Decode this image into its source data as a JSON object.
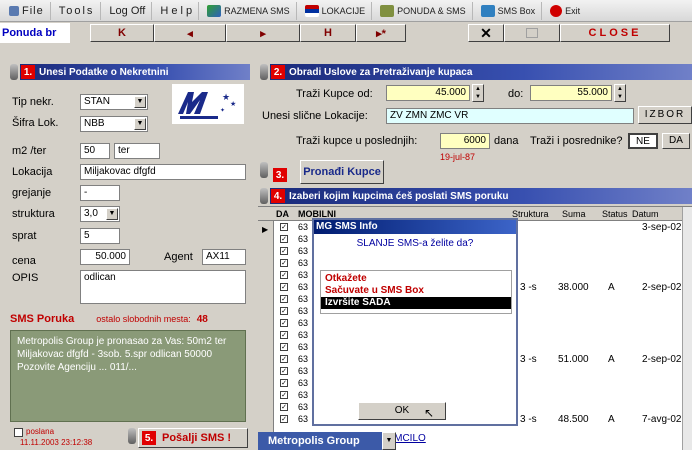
{
  "menu": {
    "file": "File",
    "tools": "Tools",
    "logoff": "Log Off",
    "help": "H e l p",
    "razmena": "RAZMENA SMS",
    "lokacije": "LOKACIJE",
    "ponuda_sms": "PONUDA & SMS",
    "sms_box": "SMS Box",
    "exit": "Exit"
  },
  "nav": {
    "ponuda_label": "Ponuda br",
    "btn_first": "K",
    "btn_prev": "◂",
    "btn_next": "▸",
    "btn_last": "H",
    "btn_new": "▸*",
    "btn_delete": "✕",
    "close": "CLOSE"
  },
  "section1": {
    "num": "1.",
    "title": "Unesi Podatke o Nekretnini",
    "tip_label": "Tip nekr.",
    "tip_value": "STAN",
    "sifra_label": "Šifra Lok.",
    "sifra_value": "NBB",
    "m2_label": "m2  /ter",
    "m2_value": "50",
    "ter_value": "ter",
    "lokacija_label": "Lokacija",
    "lokacija_value": "Miljakovac dfgfd",
    "grejanje_label": "grejanje",
    "grejanje_value": "-",
    "struktura_label": "struktura",
    "struktura_value": "3,0",
    "sprat_label": "sprat",
    "sprat_value": "5",
    "cena_label": "cena",
    "cena_value": "50.000",
    "agent_label": "Agent",
    "agent_value": "AX11",
    "opis_label": "OPIS",
    "opis_value": "odlican"
  },
  "sms": {
    "title": "SMS Poruka",
    "remaining_label": "ostalo slobodnih mesta:",
    "remaining_value": "48",
    "text": "Metropolis Group je pronasao za Vas: 50m2 ter Miljakovac dfgfd - 3sob. 5.spr odlican 50000 Pozovite Agenciju ... 011/...",
    "poslana_label": "poslana",
    "timestamp": "11.11.2003 23:12:38",
    "send_num": "5.",
    "send_label": "Pošalji SMS !"
  },
  "section2": {
    "num": "2.",
    "title": "Obradi Uslove za Pretraživanje kupaca",
    "trazi_od_label": "Traži Kupce od:",
    "trazi_od_value": "45.000",
    "do_label": "do:",
    "do_value": "55.000",
    "slicne_label": "Unesi slične Lokacije:",
    "slicne_value": "ZV ZMN ZMC VR",
    "izbor": "IZBOR",
    "poslednjih_label": "Traži kupce u poslednjih:",
    "poslednjih_value": "6000",
    "dana": "dana",
    "posrednike_label": "Traži i posrednike?",
    "ne": "NE",
    "da": "DA",
    "date": "19-jul-87"
  },
  "section3": {
    "num": "3.",
    "button": "Pronađi Kupce"
  },
  "section4": {
    "num": "4.",
    "title": "Izaberi kojim kupcima ćeš poslati SMS poruku",
    "headers": [
      "DA",
      "MOBILNI",
      "Struktura",
      "Suma",
      "Status",
      "Datum"
    ],
    "row_prefix": "63",
    "rows": [
      {
        "struktura": "",
        "suma": "",
        "status": "",
        "datum": "3-sep-02"
      },
      {
        "struktura": "3 -s",
        "suma": "38.000",
        "status": "A",
        "datum": "2-sep-02"
      },
      {
        "struktura": "3 -s",
        "suma": "51.000",
        "status": "A",
        "datum": "2-sep-02"
      },
      {
        "struktura": "3 -s",
        "suma": "48.500",
        "status": "A",
        "datum": "7-avg-02"
      }
    ],
    "last_name": "MOMCILO"
  },
  "popup": {
    "title": "MG SMS Info",
    "question": "SLANJE SMS-a želite da?",
    "options": [
      "Otkažete",
      "Sačuvate u SMS Box",
      "Izvršite SADA"
    ],
    "ok": "OK"
  },
  "footer": {
    "company": "Metropolis Group"
  },
  "colors": {
    "accent_red": "#e00000",
    "title_blue": "#1a2a7a",
    "sms_bg": "#8a9a78"
  }
}
